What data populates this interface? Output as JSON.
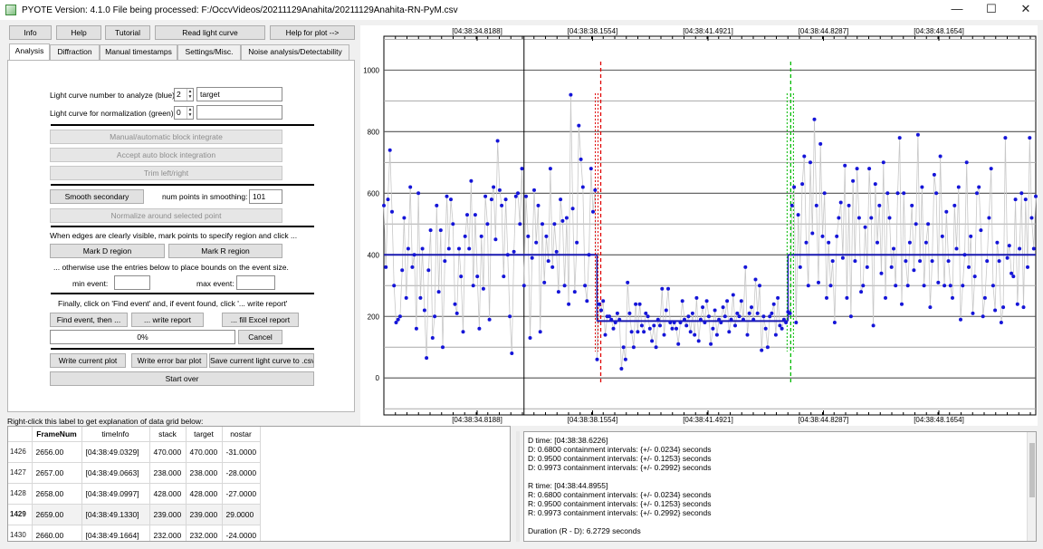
{
  "window": {
    "title": "PYOTE Version: 4.1.0  File being processed: F:/OccvVideos/20211129Anahita/20211129Anahita-RN-PyM.csv",
    "minimize": "—",
    "maximize": "☐",
    "close": "✕"
  },
  "top_buttons": {
    "info": "Info",
    "help": "Help",
    "tutorial": "Tutorial",
    "read_light_curve": "Read light curve",
    "help_for_plot": "Help for plot -->"
  },
  "tabs": [
    "Analysis",
    "Diffraction",
    "Manual timestamps",
    "Settings/Misc.",
    "Noise analysis/Detectability"
  ],
  "analysis": {
    "lc_number_label": "Light curve number to analyze (blue):",
    "lc_number_value": "2",
    "lc_name_value": "target",
    "norm_label": "Light curve for normalization (green):",
    "norm_value": "0",
    "norm_name_value": "",
    "manual_block": "Manual/automatic block integrate",
    "accept_block": "Accept auto block integration",
    "trim": "Trim left/right",
    "smooth_secondary": "Smooth secondary",
    "num_points_label": "num points in smoothing:",
    "num_points_value": "101",
    "normalize": "Normalize around selected point",
    "edges_text": "When edges are clearly visible, mark points to specify region and click ...",
    "mark_d": "Mark D region",
    "mark_r": "Mark R region",
    "otherwise_text": "... otherwise use the entries below to place bounds on the event size.",
    "min_event_label": "min event:",
    "max_event_label": "max event:",
    "min_event_value": "",
    "max_event_value": "",
    "finally_text": "Finally, click on 'Find event' and, if event found, click '... write report'",
    "find_event": "Find event, then ...",
    "write_report": "... write report",
    "fill_excel": "... fill Excel report",
    "progress_text": "0%",
    "progress_value": 0,
    "cancel": "Cancel",
    "write_plot": "Write current plot",
    "write_error_bar": "Write error bar plot",
    "save_csv": "Save current light curve to .csv",
    "start_over": "Start over"
  },
  "grid_hint": "Right-click this label to get explanation of data grid below:",
  "grid": {
    "columns": [
      "FrameNum",
      "timeInfo",
      "stack",
      "target",
      "nostar"
    ],
    "rows": [
      {
        "idx": "1426",
        "cells": [
          "2656.00",
          "[04:38:49.0329]",
          "470.000",
          "470.000",
          "-31.0000"
        ]
      },
      {
        "idx": "1427",
        "cells": [
          "2657.00",
          "[04:38:49.0663]",
          "238.000",
          "238.000",
          "-28.0000"
        ]
      },
      {
        "idx": "1428",
        "cells": [
          "2658.00",
          "[04:38:49.0997]",
          "428.000",
          "428.000",
          "-27.0000"
        ]
      },
      {
        "idx": "1429",
        "cells": [
          "2659.00",
          "[04:38:49.1330]",
          "239.000",
          "239.000",
          "29.0000"
        ]
      },
      {
        "idx": "1430",
        "cells": [
          "2660.00",
          "[04:38:49.1664]",
          "232.000",
          "232.000",
          "-24.0000"
        ]
      }
    ]
  },
  "report_lines": [
    "D time: [04:38:38.6226]",
    "D: 0.6800 containment intervals: {+/- 0.0234} seconds",
    "D: 0.9500 containment intervals: {+/- 0.1253} seconds",
    "D: 0.9973 containment intervals: {+/- 0.2992} seconds",
    "",
    "R time: [04:38:44.8955]",
    "R: 0.6800 containment intervals: {+/- 0.0234} seconds",
    "R: 0.9500 containment intervals: {+/- 0.1253} seconds",
    "R: 0.9973 containment intervals: {+/- 0.2992} seconds",
    "",
    "Duration (R - D): 6.2729 seconds"
  ],
  "chart_data": {
    "type": "scatter",
    "title": "",
    "xlabel": "",
    "ylabel": "",
    "x_tick_labels": [
      "[04:38:34.8188]",
      "[04:38:38.1554]",
      "[04:38:41.4921]",
      "[04:38:44.8287]",
      "[04:38:48.1654]"
    ],
    "y_ticks": [
      0,
      200,
      400,
      600,
      800,
      1000
    ],
    "ylim": [
      -120,
      1110
    ],
    "baseline_level": 400,
    "event_level": 185,
    "d_edge_index": 105,
    "r_edge_index": 199,
    "cursor_index": 69,
    "colors": {
      "points": "#1515d8",
      "connect": "#c8c8c8",
      "d_marker": "#e00000",
      "r_marker": "#00bb00",
      "level": "#1a1ab0"
    },
    "values": [
      560,
      360,
      580,
      740,
      540,
      300,
      180,
      190,
      200,
      350,
      520,
      260,
      420,
      620,
      360,
      400,
      160,
      600,
      260,
      420,
      220,
      65,
      350,
      480,
      130,
      200,
      560,
      280,
      480,
      100,
      380,
      590,
      420,
      580,
      500,
      240,
      210,
      420,
      330,
      150,
      460,
      530,
      420,
      640,
      300,
      530,
      330,
      160,
      460,
      290,
      590,
      500,
      190,
      580,
      620,
      450,
      770,
      610,
      560,
      330,
      580,
      400,
      200,
      80,
      410,
      590,
      600,
      500,
      680,
      300,
      590,
      460,
      130,
      390,
      610,
      440,
      560,
      150,
      500,
      310,
      460,
      380,
      680,
      360,
      500,
      410,
      280,
      580,
      510,
      300,
      520,
      240,
      920,
      550,
      280,
      440,
      820,
      710,
      620,
      300,
      250,
      400,
      680,
      540,
      610,
      60,
      240,
      220,
      250,
      140,
      200,
      200,
      190,
      160,
      180,
      210,
      190,
      30,
      100,
      60,
      310,
      210,
      150,
      100,
      240,
      150,
      240,
      170,
      150,
      210,
      200,
      160,
      120,
      170,
      100,
      190,
      170,
      290,
      140,
      220,
      290,
      180,
      160,
      180,
      160,
      110,
      180,
      250,
      190,
      170,
      200,
      150,
      210,
      140,
      260,
      120,
      190,
      230,
      180,
      250,
      200,
      110,
      160,
      220,
      140,
      190,
      180,
      230,
      200,
      250,
      150,
      190,
      270,
      170,
      210,
      200,
      250,
      190,
      360,
      140,
      210,
      230,
      190,
      320,
      210,
      300,
      90,
      200,
      160,
      100,
      200,
      210,
      240,
      140,
      260,
      170,
      160,
      190,
      180,
      215,
      210,
      560,
      620,
      180,
      530,
      360,
      630,
      720,
      440,
      300,
      700,
      470,
      840,
      560,
      310,
      760,
      460,
      600,
      260,
      440,
      300,
      380,
      180,
      460,
      520,
      570,
      390,
      690,
      260,
      560,
      200,
      640,
      380,
      680,
      520,
      280,
      300,
      490,
      360,
      680,
      520,
      170,
      630,
      440,
      560,
      340,
      700,
      260,
      600,
      520,
      360,
      420,
      300,
      600,
      780,
      240,
      600,
      380,
      300,
      440,
      560,
      350,
      500,
      790,
      380,
      620,
      300,
      440,
      500,
      230,
      380,
      660,
      600,
      310,
      720,
      460,
      300,
      540,
      380,
      300,
      260,
      560,
      420,
      620,
      190,
      300,
      400,
      700,
      360,
      460,
      210,
      330,
      600,
      620,
      480,
      200,
      260,
      380,
      520,
      680,
      300,
      220,
      440,
      380,
      180,
      230,
      780,
      390,
      430,
      340,
      330,
      580,
      240,
      420,
      600,
      230,
      580,
      360,
      780,
      520,
      420,
      590
    ]
  }
}
